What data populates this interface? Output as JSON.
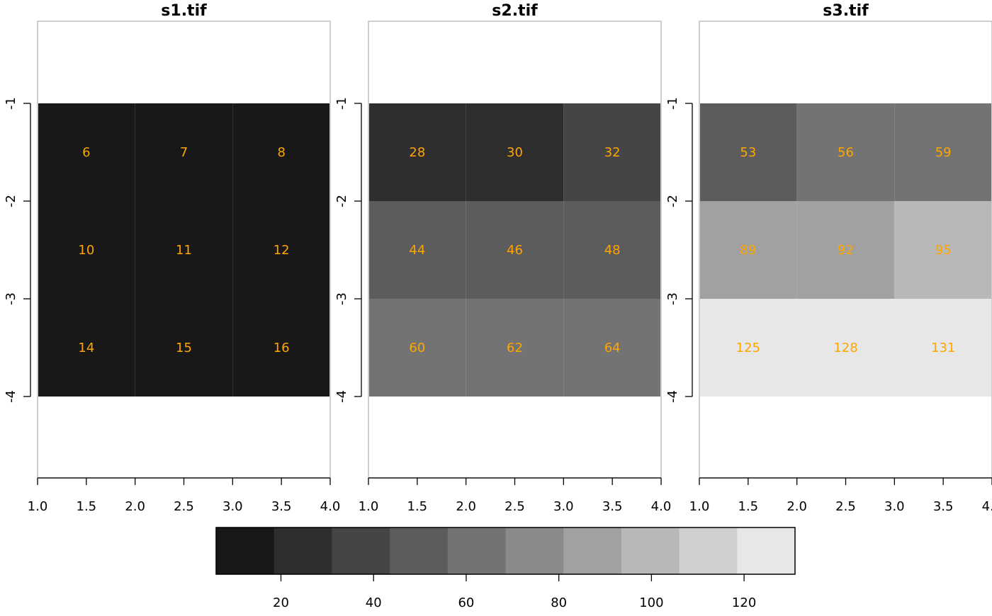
{
  "chart_data": {
    "type": "heatmap",
    "panels": [
      {
        "title": "s1.tif",
        "x_ticks": [
          "1.0",
          "1.5",
          "2.0",
          "2.5",
          "3.0",
          "3.5",
          "4.0"
        ],
        "y_ticks": [
          "-1",
          "-2",
          "-3",
          "-4"
        ],
        "grid": [
          [
            6,
            7,
            8
          ],
          [
            10,
            11,
            12
          ],
          [
            14,
            15,
            16
          ]
        ]
      },
      {
        "title": "s2.tif",
        "x_ticks": [
          "1.0",
          "1.5",
          "2.0",
          "2.5",
          "3.0",
          "3.5",
          "4.0"
        ],
        "y_ticks": [
          "-1",
          "-2",
          "-3",
          "-4"
        ],
        "grid": [
          [
            28,
            30,
            32
          ],
          [
            44,
            46,
            48
          ],
          [
            60,
            62,
            64
          ]
        ]
      },
      {
        "title": "s3.tif",
        "x_ticks": [
          "1.0",
          "1.5",
          "2.0",
          "2.5",
          "3.0",
          "3.5",
          "4.0"
        ],
        "y_ticks": [
          "-1",
          "-2",
          "-3",
          "-4"
        ],
        "grid": [
          [
            53,
            56,
            59
          ],
          [
            89,
            92,
            95
          ],
          [
            125,
            128,
            131
          ]
        ]
      }
    ],
    "x_range": [
      1,
      4
    ],
    "y_range": [
      -4,
      -1
    ],
    "cell_label_color": "#FFA500",
    "legend": {
      "range": [
        6,
        131
      ],
      "bins": 10,
      "colors": [
        "#181818",
        "#2e2e2e",
        "#454545",
        "#5c5c5c",
        "#737373",
        "#8a8a8a",
        "#a1a1a1",
        "#b8b8b8",
        "#d0d0d0",
        "#e7e7e7"
      ],
      "ticks": [
        "20",
        "40",
        "60",
        "80",
        "100",
        "120"
      ]
    }
  }
}
